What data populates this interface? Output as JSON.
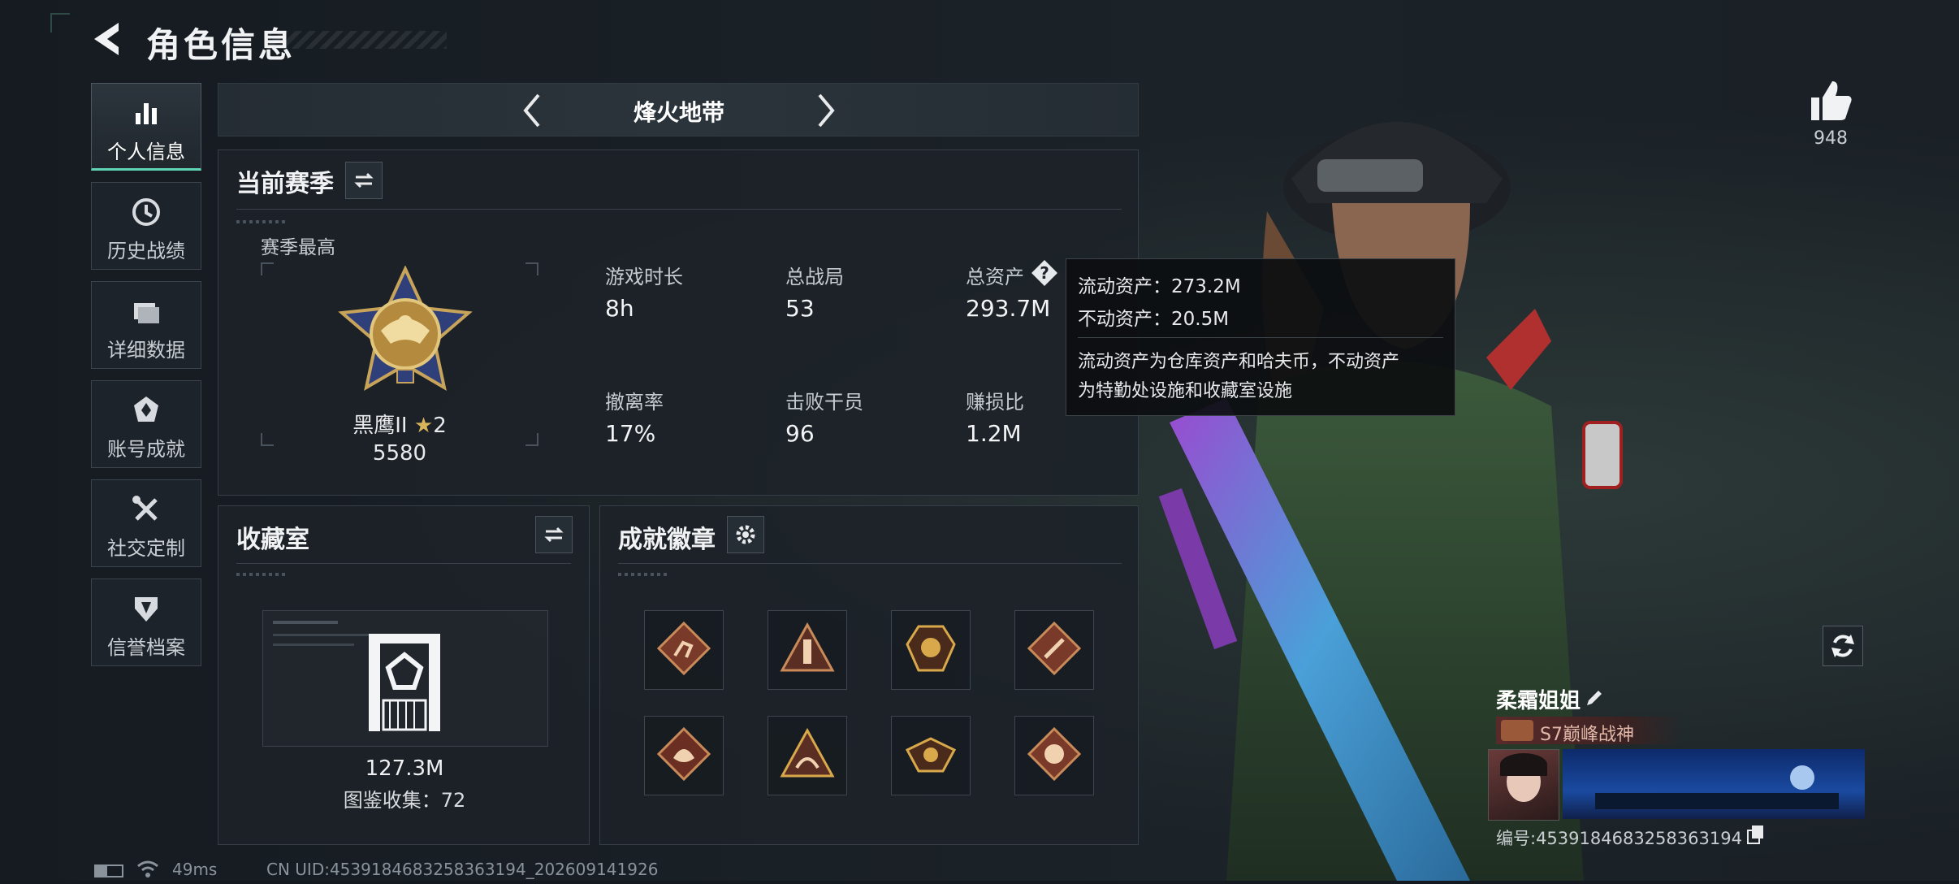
{
  "header": {
    "title": "角色信息"
  },
  "sidebar": {
    "items": [
      {
        "label": "个人信息",
        "icon": "bar-chart-icon",
        "active": true
      },
      {
        "label": "历史战绩",
        "icon": "clock-icon",
        "active": false
      },
      {
        "label": "详细数据",
        "icon": "folder-icon",
        "active": false
      },
      {
        "label": "账号成就",
        "icon": "achievement-icon",
        "active": false
      },
      {
        "label": "社交定制",
        "icon": "tools-icon",
        "active": false
      },
      {
        "label": "信誉档案",
        "icon": "shield-icon",
        "active": false
      }
    ]
  },
  "mode": {
    "name": "烽火地带"
  },
  "season": {
    "title": "当前赛季",
    "best_label": "赛季最高",
    "rank_name": "黑鹰II",
    "rank_stars": "2",
    "rank_points": "5580",
    "stats": [
      {
        "label": "游戏时长",
        "value": "8h"
      },
      {
        "label": "总战局",
        "value": "53"
      },
      {
        "label": "总资产",
        "value": "293.7M"
      },
      {
        "label": "撤离率",
        "value": "17%"
      },
      {
        "label": "击败干员",
        "value": "96"
      },
      {
        "label": "赚损比",
        "value": "1.2M"
      }
    ]
  },
  "tooltip": {
    "line1": "流动资产：273.2M",
    "line2": "不动资产：20.5M",
    "desc1": "流动资产为仓库资产和哈夫币，不动资产",
    "desc2": "为特勤处设施和收藏室设施"
  },
  "collection": {
    "title": "收藏室",
    "value": "127.3M",
    "catalog": "图鉴收集：72"
  },
  "achievements": {
    "title": "成就徽章",
    "badges": [
      "badge-runner-icon",
      "badge-tower-icon",
      "badge-crest-icon",
      "badge-wrench-icon",
      "badge-dragon-icon",
      "badge-snake-icon",
      "badge-eagle-icon",
      "badge-beast-icon"
    ]
  },
  "profile": {
    "likes": "948",
    "player_name": "柔霜姐姐",
    "title_tag": "S7巅峰战神",
    "id_line": "编号:4539184683258363194"
  },
  "status_bar": {
    "ping": "49ms",
    "uid": "CN UID:4539184683258363194_202609141926"
  },
  "colors": {
    "accent": "#5fd5b5",
    "star": "#d8b45a",
    "badge_bg": "#7a3a2a"
  }
}
